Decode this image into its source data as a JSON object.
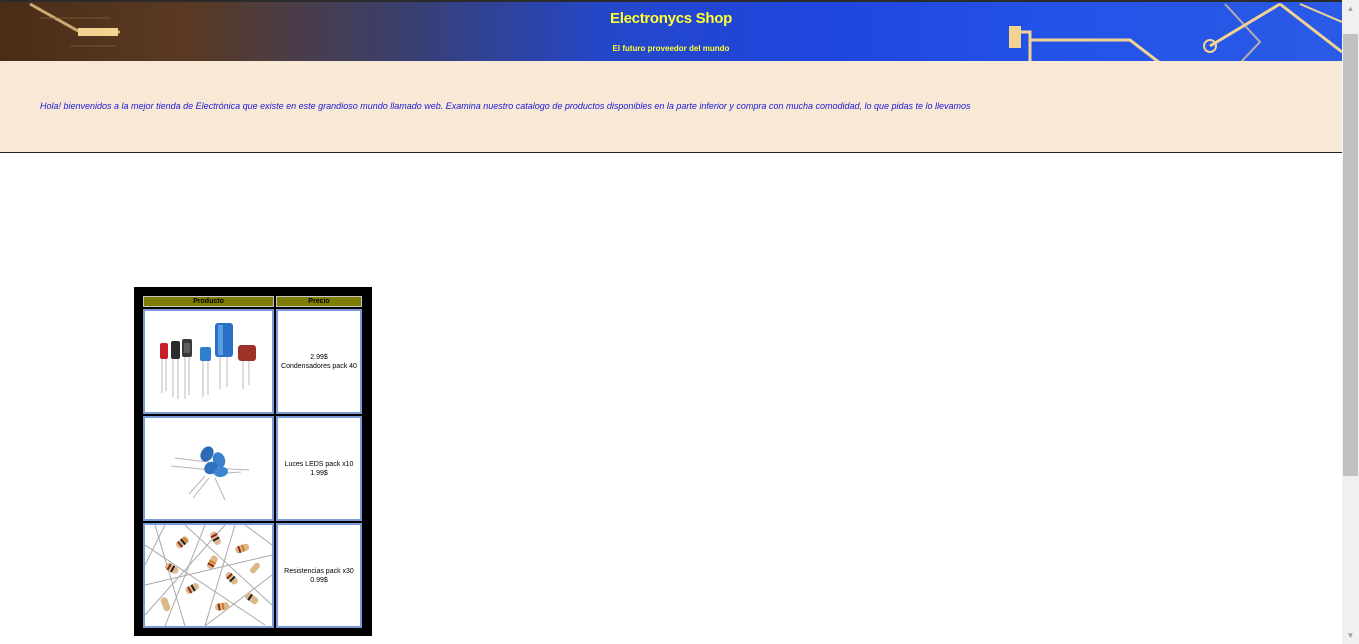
{
  "header": {
    "title": "Electronycs Shop",
    "subtitle": "El futuro proveedor del mundo"
  },
  "welcome": {
    "message": "Hola! bienvenidos a la mejor tienda de Electrónica que existe en este grandioso mundo llamado web. Examina nuestro catalogo de productos disponibles en la parte inferior y compra con mucha comodidad, lo que pidas te lo llevamos"
  },
  "catalog": {
    "headers": [
      "Producto",
      "Precio"
    ],
    "products": [
      {
        "image_icon": "capacitors-image",
        "line1": "2.99$",
        "line2": "Condensadores pack 40"
      },
      {
        "image_icon": "leds-image",
        "line1": "Luces LEDS pack x10",
        "line2": "1.99$"
      },
      {
        "image_icon": "resistors-image",
        "line1": "Resistencias pack x30",
        "line2": "0.99$"
      }
    ]
  },
  "scrollbar": {
    "up_icon": "scroll-up-arrow-icon",
    "down_icon": "scroll-down-arrow-icon"
  },
  "colors": {
    "title": "#ffff33",
    "welcome_bg": "#f8e9d6",
    "welcome_text": "#1a18d8",
    "table_header": "#7d7d00",
    "cell_border": "#7a9ad8"
  }
}
